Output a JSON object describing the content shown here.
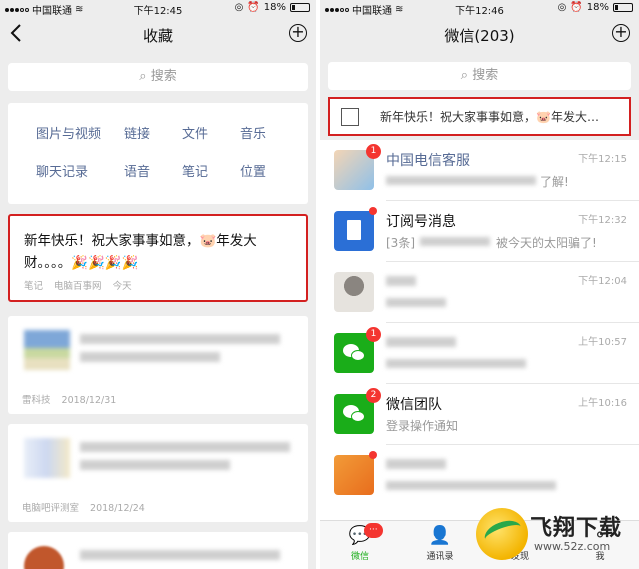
{
  "left": {
    "status": {
      "carrier": "中国联通",
      "time": "下午12:45",
      "battery": "18%",
      "battery_level": 0.18
    },
    "nav": {
      "title": "收藏",
      "back_icon": "chevron-left-icon",
      "add_icon": "plus-circle-icon"
    },
    "search": {
      "placeholder": "搜索"
    },
    "categories": [
      "图片与视频",
      "链接",
      "文件",
      "音乐",
      "聊天记录",
      "语音",
      "笔记",
      "位置"
    ],
    "notes": [
      {
        "text": "新年快乐！祝大家事事如意，🐷年发大财。。。。🎉🎉🎉🎉",
        "tag": "笔记",
        "source": "电脑百事网",
        "date": "今天",
        "highlighted": true
      },
      {
        "source": "雷科技",
        "date": "2018/12/31"
      },
      {
        "source": "电脑吧评测室",
        "date": "2018/12/24"
      }
    ]
  },
  "right": {
    "status": {
      "carrier": "中国联通",
      "time": "下午12:46",
      "battery": "18%",
      "battery_level": 0.18
    },
    "nav": {
      "title": "微信(203)",
      "add_icon": "plus-circle-icon"
    },
    "search": {
      "placeholder": "搜索"
    },
    "pinned_note": {
      "text": "新年快乐！祝大家事事如意，🐷年发大…",
      "icon": "box-icon"
    },
    "chats": [
      {
        "name": "中国电信客服",
        "preview": "了解!",
        "time": "下午12:15",
        "badge": "1",
        "name_color": "#576b95"
      },
      {
        "name": "订阅号消息",
        "preview": "[3条]",
        "preview_tail": "被今天的太阳骗了!",
        "time": "下午12:32",
        "dot": true
      },
      {
        "name": "",
        "preview": "",
        "time": "下午12:04"
      },
      {
        "name": "",
        "preview": "",
        "time": "上午10:57",
        "badge": "1"
      },
      {
        "name": "微信团队",
        "preview": "登录操作通知",
        "time": "上午10:16",
        "badge": "2"
      },
      {
        "name": "",
        "preview": "",
        "time": "",
        "badge": ""
      }
    ],
    "tabs": [
      {
        "label": "微信",
        "icon": "chat-bubble-icon",
        "active": true,
        "badge": "···"
      },
      {
        "label": "通讯录",
        "icon": "contacts-icon"
      },
      {
        "label": "发现",
        "icon": "compass-icon"
      },
      {
        "label": "我",
        "icon": "person-icon"
      }
    ]
  },
  "watermark": {
    "title": "飞翔下载",
    "url": "www.52z.com"
  },
  "colors": {
    "accent_green": "#1aad19",
    "link_blue": "#576b95",
    "highlight_red": "#d32020",
    "badge_red": "#f43530"
  }
}
